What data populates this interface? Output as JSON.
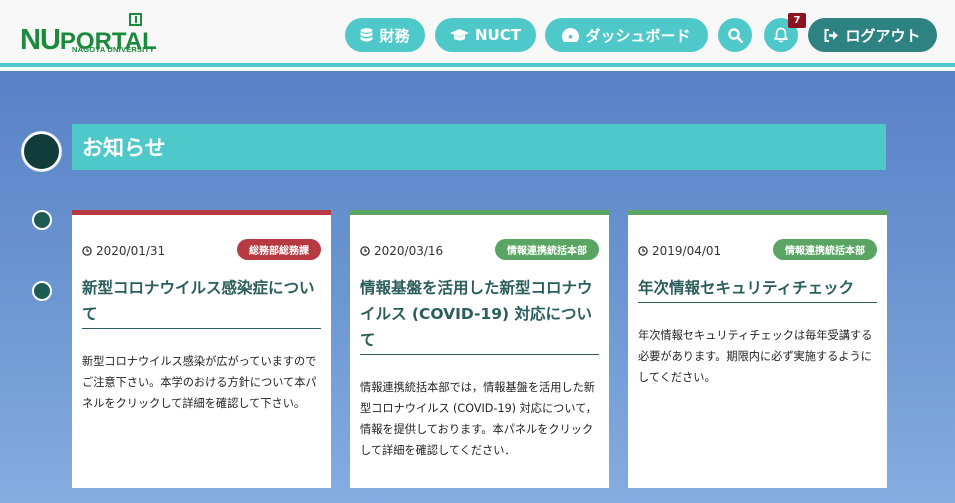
{
  "logo": {
    "main_nu": "NU",
    "main_portal": "PORTAL",
    "sub": "NAGOYA UNIVERSITY"
  },
  "header": {
    "nav": [
      {
        "label": "財務",
        "icon": "database-icon"
      },
      {
        "label": "NUCT",
        "icon": "graduation-cap-icon"
      },
      {
        "label": "ダッシュボード",
        "icon": "dashboard-icon"
      }
    ],
    "search_icon": "search-icon",
    "bell_icon": "bell-icon",
    "notification_count": "7",
    "logout_label": "ログアウト",
    "colors": {
      "accent": "#4ec8c8",
      "dark_accent": "#2e8282",
      "badge": "#8d1320"
    }
  },
  "section": {
    "title": "お知らせ"
  },
  "cards": [
    {
      "date": "2020/01/31",
      "tag": "総務部総務課",
      "tag_color": "#b73a43",
      "title": "新型コロナウイルス感染症について",
      "body": "新型コロナウイルス感染が広がっていますのでご注意下さい。本学のおける方針について本パネルをクリックして詳細を確認して下さい。"
    },
    {
      "date": "2020/03/16",
      "tag": "情報連携統括本部",
      "tag_color": "#5aa563",
      "title": "情報基盤を活用した新型コロナウイルス (COVID-19) 対応について",
      "body": "情報連携統括本部では，情報基盤を活用した新型コロナウイルス (COVID-19) 対応について，情報を提供しております。本パネルをクリックして詳細を確認してください．"
    },
    {
      "date": "2019/04/01",
      "tag": "情報連携統括本部",
      "tag_color": "#5aa563",
      "title": "年次情報セキュリティチェック",
      "body": "年次情報セキュリティチェックは毎年受講する必要があります。期限内に必ず実施するようにしてください。"
    }
  ]
}
